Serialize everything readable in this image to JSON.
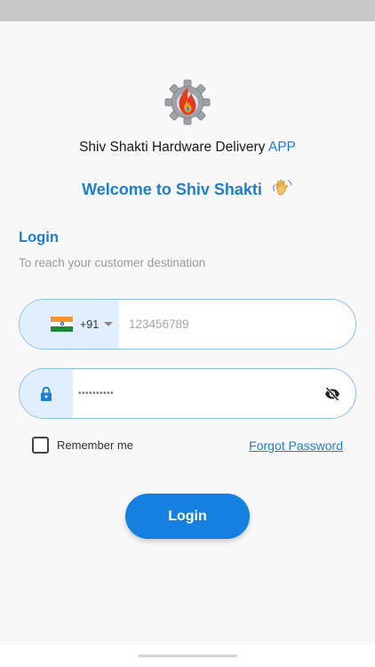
{
  "header": {
    "logo_icon": "gear-flame-logo",
    "app_title": "Shiv Shakti Hardware Delivery",
    "app_title_accent": "APP",
    "welcome": "Welcome to Shiv Shakti",
    "welcome_icon": "waving-hand-emoji"
  },
  "login": {
    "heading": "Login",
    "subtitle": "To reach your customer destination"
  },
  "phone": {
    "flag_icon": "india-flag",
    "dial_code": "+91",
    "placeholder": "123456789",
    "value": ""
  },
  "password": {
    "lock_icon": "lock-icon",
    "masked_value": "••••••••••",
    "visibility_icon": "eye-off-icon"
  },
  "remember": {
    "label": "Remember me",
    "checked": false
  },
  "forgot_password": "Forgot Password",
  "submit_label": "Login",
  "colors": {
    "accent": "#1b7fd6",
    "button": "#1580df",
    "field_border": "#8cc0ea",
    "field_prefix": "#e1eefb"
  }
}
